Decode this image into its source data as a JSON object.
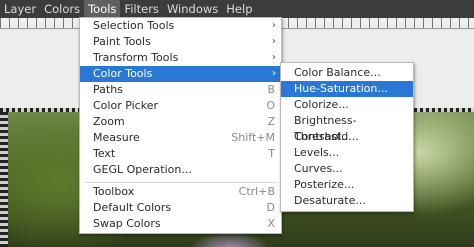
{
  "menubar": {
    "items": [
      "Layer",
      "Colors",
      "Tools",
      "Filters",
      "Windows",
      "Help"
    ]
  },
  "tools_menu": {
    "items": [
      {
        "label": "Selection Tools",
        "accel": "",
        "submenu": true
      },
      {
        "label": "Paint Tools",
        "accel": "",
        "submenu": true
      },
      {
        "label": "Transform Tools",
        "accel": "",
        "submenu": true
      },
      {
        "label": "Color Tools",
        "accel": "",
        "submenu": true,
        "highlighted": true
      },
      {
        "label": "Paths",
        "accel": "B"
      },
      {
        "label": "Color Picker",
        "accel": "O"
      },
      {
        "label": "Zoom",
        "accel": "Z"
      },
      {
        "label": "Measure",
        "accel": "Shift+M"
      },
      {
        "label": "Text",
        "accel": "T"
      },
      {
        "label": "GEGL Operation...",
        "accel": ""
      },
      {
        "label": "Toolbox",
        "accel": "Ctrl+B"
      },
      {
        "label": "Default Colors",
        "accel": "D"
      },
      {
        "label": "Swap Colors",
        "accel": "X"
      }
    ]
  },
  "color_tools_menu": {
    "items": [
      {
        "label": "Color Balance..."
      },
      {
        "label": "Hue-Saturation...",
        "highlighted": true
      },
      {
        "label": "Colorize..."
      },
      {
        "label": "Brightness-Contrast..."
      },
      {
        "label": "Threshold..."
      },
      {
        "label": "Levels..."
      },
      {
        "label": "Curves..."
      },
      {
        "label": "Posterize..."
      },
      {
        "label": "Desaturate..."
      }
    ]
  },
  "colors": {
    "highlight": "#2a78d6",
    "menubar": "#3c3c3c",
    "menu_bg": "#ffffff"
  }
}
